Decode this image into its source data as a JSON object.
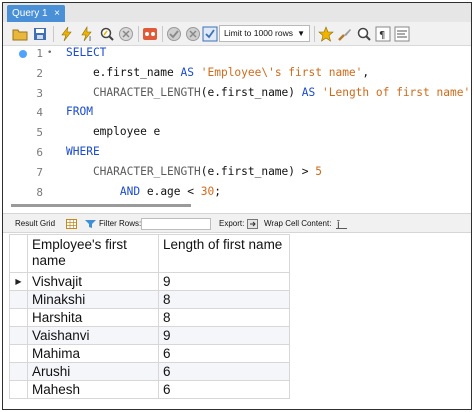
{
  "tab": {
    "title": "Query 1",
    "close": "×"
  },
  "toolbar": {
    "limit_label": "Limit to 1000 rows",
    "icons": [
      "folder-icon",
      "save-icon",
      "lightning-icon",
      "lightning-cursor-icon",
      "magnifier-icon",
      "stop-icon",
      "commit-icon",
      "rollback-icon",
      "toggle-icon",
      "autocommit-icon",
      "star-icon",
      "brush-icon",
      "search-icon",
      "paragraph-icon",
      "wrap-icon"
    ]
  },
  "editor": {
    "lines": [
      {
        "n": "1",
        "parts": [
          {
            "t": "SELECT",
            "c": "kw"
          }
        ]
      },
      {
        "n": "2",
        "parts": [
          {
            "t": "    e.first_name ",
            "c": ""
          },
          {
            "t": "AS",
            "c": "kw"
          },
          {
            "t": " ",
            "c": ""
          },
          {
            "t": "'Employee\\'s first name'",
            "c": "str"
          },
          {
            "t": ",",
            "c": ""
          }
        ]
      },
      {
        "n": "3",
        "parts": [
          {
            "t": "    CHARACTER_LENGTH",
            "c": "fn"
          },
          {
            "t": "(e.first_name) ",
            "c": ""
          },
          {
            "t": "AS",
            "c": "kw"
          },
          {
            "t": " ",
            "c": ""
          },
          {
            "t": "'Length of first name'",
            "c": "str"
          }
        ]
      },
      {
        "n": "4",
        "parts": [
          {
            "t": "FROM",
            "c": "kw"
          }
        ]
      },
      {
        "n": "5",
        "parts": [
          {
            "t": "    employee e",
            "c": ""
          }
        ]
      },
      {
        "n": "6",
        "parts": [
          {
            "t": "WHERE",
            "c": "kw"
          }
        ]
      },
      {
        "n": "7",
        "parts": [
          {
            "t": "    CHARACTER_LENGTH",
            "c": "fn"
          },
          {
            "t": "(e.first_name) > ",
            "c": ""
          },
          {
            "t": "5",
            "c": "num"
          }
        ]
      },
      {
        "n": "8",
        "parts": [
          {
            "t": "        ",
            "c": ""
          },
          {
            "t": "AND",
            "c": "kw"
          },
          {
            "t": " e.age < ",
            "c": ""
          },
          {
            "t": "30",
            "c": "num"
          },
          {
            "t": ";",
            "c": ""
          }
        ]
      }
    ]
  },
  "result_toolbar": {
    "result_grid": "Result Grid",
    "filter_rows": "Filter Rows:",
    "export": "Export:",
    "wrap_cell": "Wrap Cell Content:"
  },
  "grid": {
    "headers": [
      "Employee's first name",
      "Length of first name"
    ],
    "rows": [
      [
        "Vishvajit",
        "9"
      ],
      [
        "Minakshi",
        "8"
      ],
      [
        "Harshita",
        "8"
      ],
      [
        "Vaishanvi",
        "9"
      ],
      [
        "Mahima",
        "6"
      ],
      [
        "Arushi",
        "6"
      ],
      [
        "Mahesh",
        "6"
      ]
    ],
    "current_row_marker": "▶"
  },
  "colors": {
    "keyword": "#1a4bd0",
    "string": "#d06a1b",
    "tab_active": "#4a90d6"
  }
}
